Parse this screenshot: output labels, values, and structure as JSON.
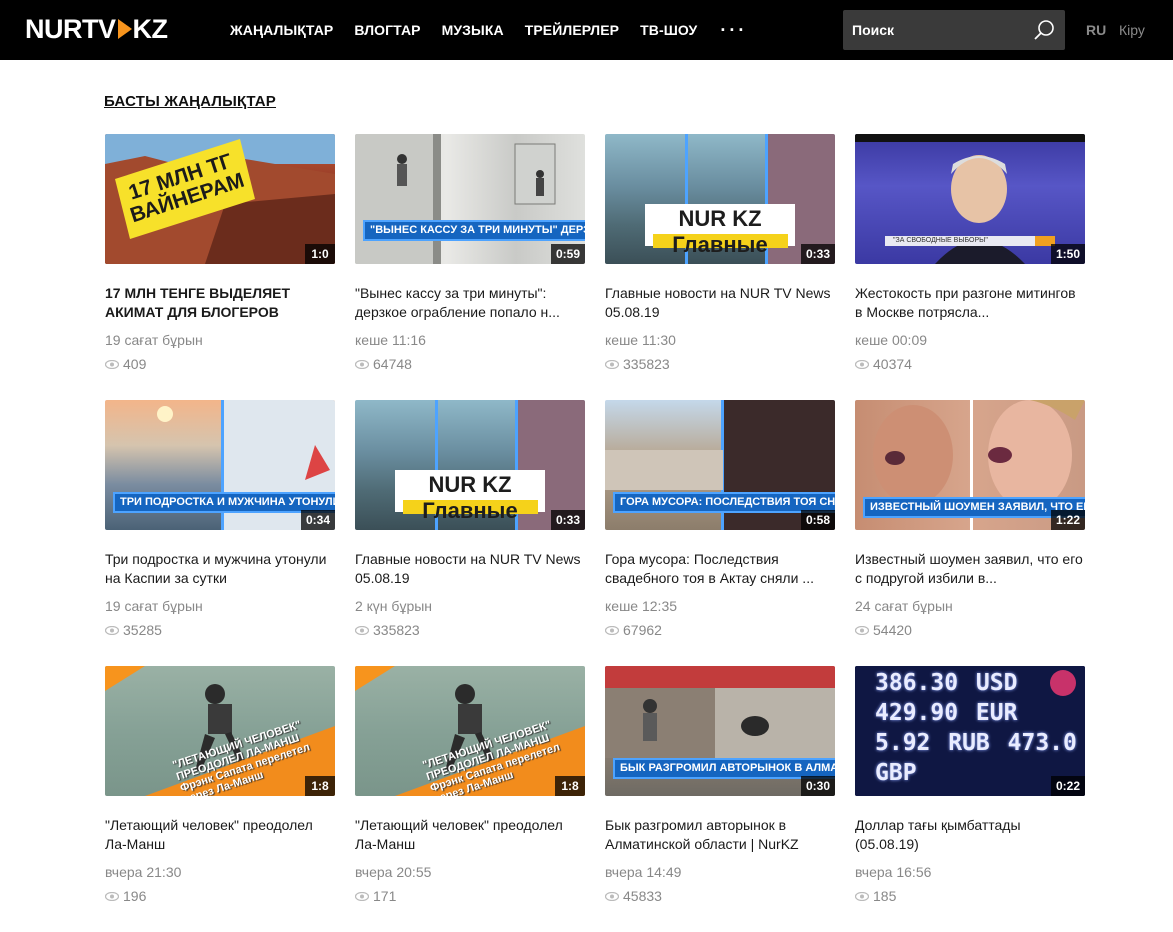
{
  "header": {
    "logo": {
      "left": "NURTV",
      "right": "KZ"
    },
    "nav": [
      "ЖАҢАЛЫҚТАР",
      "ВЛОГТАР",
      "МУЗЫКА",
      "ТРЕЙЛЕРЛЕР",
      "ТВ-ШОУ"
    ],
    "more": "···",
    "search_placeholder": "Поиск",
    "lang": "RU",
    "login": "Кіру"
  },
  "section": {
    "title": "БАСТЫ ЖАҢАЛЫҚТАР"
  },
  "colors": {
    "brand_orange": "#f7941d",
    "topbar": "#000000",
    "overlay_blue": "#1565c0",
    "meta_grey": "#888888"
  },
  "cards": [
    {
      "title": "17 МЛН ТЕНГЕ ВЫДЕЛЯЕТ АКИМАТ ДЛЯ БЛОГЕРОВ",
      "date": "19 сағат бұрын",
      "views": "409",
      "duration": "1:0",
      "thumb_text": "17 МЛН ТГ ВАЙНЕРАМ"
    },
    {
      "title": "\"Вынес кассу за три минуты\": дерзкое ограбление попало н...",
      "date": "кеше 11:16",
      "views": "64748",
      "duration": "0:59",
      "thumb_text": "\"ВЫНЕС КАССУ ЗА ТРИ МИНУТЫ\" ДЕРЗКОЕ ОГРАБЛЕНИЕ В АЛМАТ"
    },
    {
      "title": "Главные новости на NUR TV News 05.08.19",
      "date": "кеше 11:30",
      "views": "335823",
      "duration": "0:33",
      "thumb_text": "NUR KZ Главные новости на NUR TV News"
    },
    {
      "title": "Жестокость при разгоне митингов в Москве потрясла...",
      "date": "кеше 00:09",
      "views": "40374",
      "duration": "1:50",
      "thumb_text": "\"ЗА СВОБОДНЫЕ ВЫБОРЫ\""
    },
    {
      "title": "Три подростка и мужчина утонули на Каспии за сутки",
      "date": "19 сағат бұрын",
      "views": "35285",
      "duration": "0:34",
      "thumb_text": "ТРИ ПОДРОСТКА И МУЖЧИНА УТОНУЛИ НА КАСПИИ ЗА СУТ"
    },
    {
      "title": "Главные новости на NUR TV News 05.08.19",
      "date": "2 күн бұрын",
      "views": "335823",
      "duration": "0:33",
      "thumb_text": "NUR KZ Главные новости на NUR TV News"
    },
    {
      "title": "Гора мусора: Последствия свадебного тоя в Актау сняли ...",
      "date": "кеше 12:35",
      "views": "67962",
      "duration": "0:58",
      "thumb_text": "ГОРА МУСОРА: ПОСЛЕДСТВИЯ ТОЯ СНЯЛИ НА ВИДЕО"
    },
    {
      "title": "Известный шоумен заявил, что его с подругой избили в...",
      "date": "24 сағат бұрын",
      "views": "54420",
      "duration": "1:22",
      "thumb_text": "ИЗВЕСТНЫЙ ШОУМЕН ЗАЯВИЛ, ЧТО ЕГО С ПОДРУГОЙ ИЗБИЛИ В"
    },
    {
      "title": "\"Летающий человек\" преодолел Ла-Манш",
      "date": "вчера 21:30",
      "views": "196",
      "duration": "1:8",
      "thumb_text": "\"ЛЕТАЮЩИЙ ЧЕЛОВЕК\" ПРЕОДОЛЕЛ ЛА-МАНШ Фрэнк Сапата перелетел через Ла-Манш"
    },
    {
      "title": "\"Летающий человек\" преодолел Ла-Манш",
      "date": "вчера 20:55",
      "views": "171",
      "duration": "1:8",
      "thumb_text": "\"ЛЕТАЮЩИЙ ЧЕЛОВЕК\" ПРЕОДОЛЕЛ ЛА-МАНШ Фрэнк Сапата перелетел через Ла-Манш"
    },
    {
      "title": "Бык разгромил авторынок в Алматинской области | NurKZ",
      "date": "вчера 14:49",
      "views": "45833",
      "duration": "0:30",
      "thumb_text": "БЫК РАЗГРОМИЛ АВТОРЫНОК В АЛМАТИНСКОЙ ОБЛАСТИ"
    },
    {
      "title": "Доллар тағы қымбаттады (05.08.19)",
      "date": "вчера 16:56",
      "views": "185",
      "duration": "0:22",
      "thumb_text": "386.30 USD 429.90 EUR 5.92 RUB 473.0 GBP"
    }
  ]
}
